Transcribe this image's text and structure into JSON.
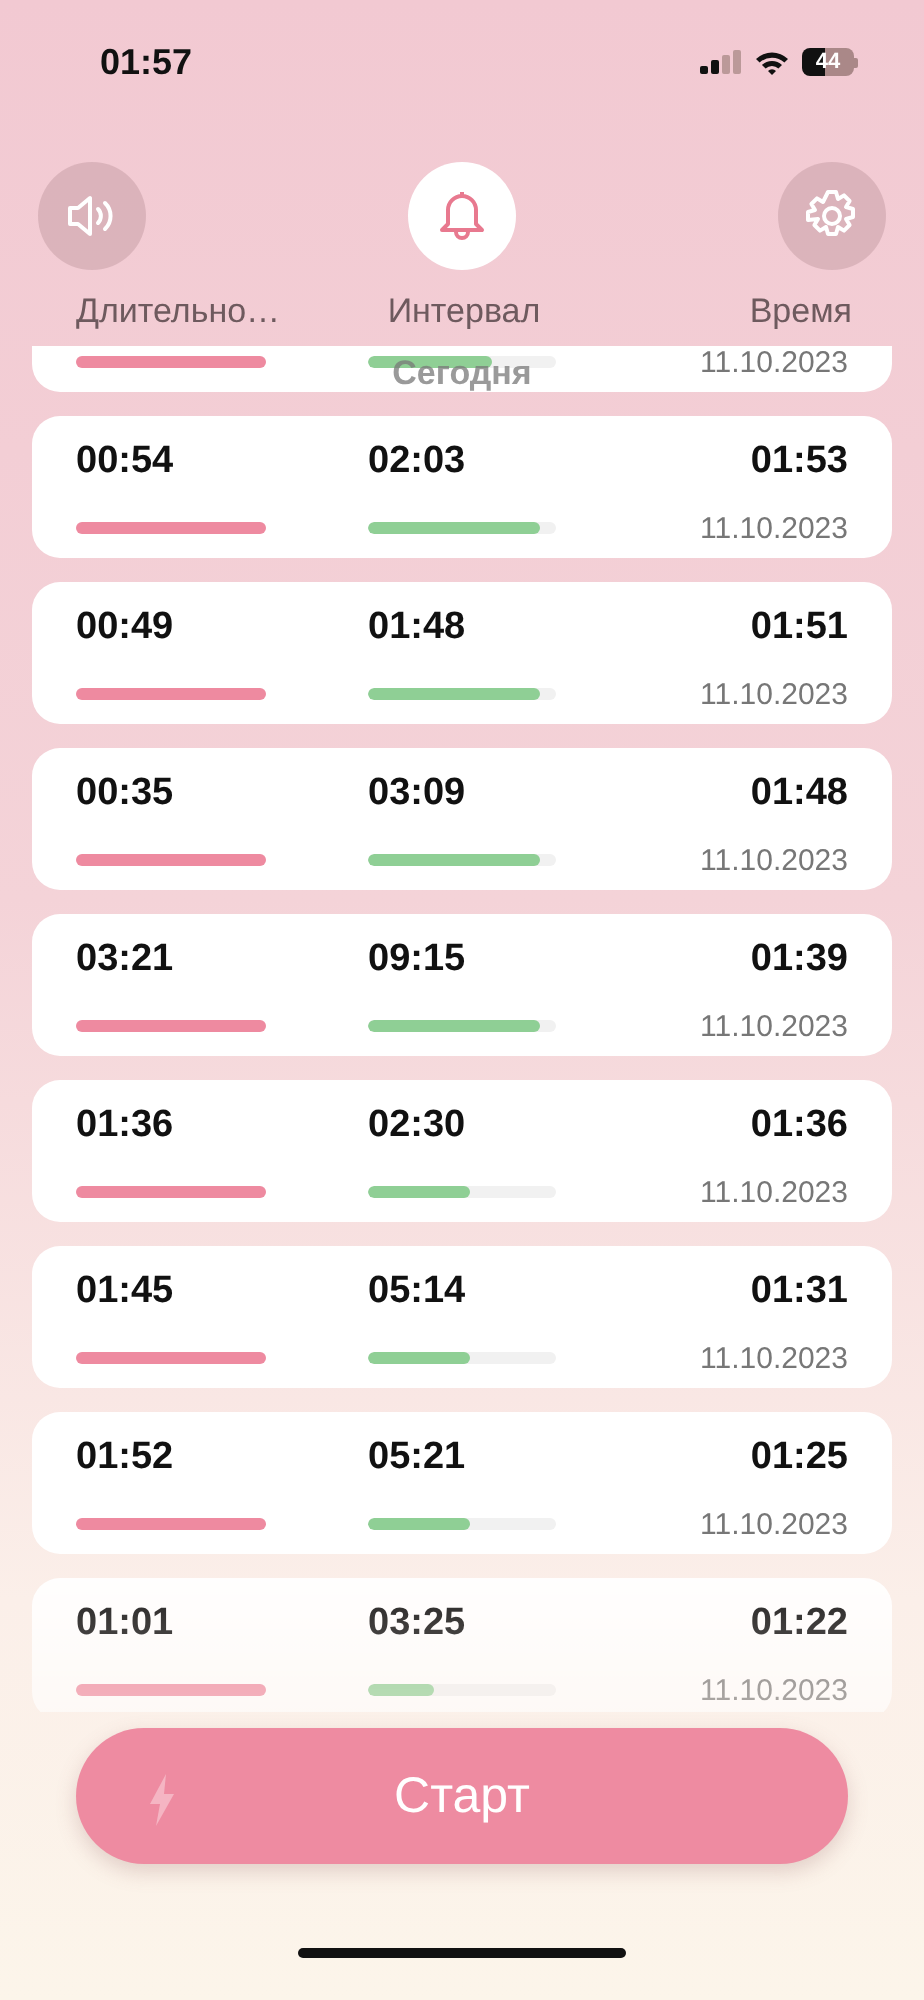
{
  "status_bar": {
    "time": "01:57",
    "battery": "44"
  },
  "tabs": [
    {
      "label": "Длительно…",
      "selected": false
    },
    {
      "label": "Интервал",
      "selected": true
    },
    {
      "label": "Время",
      "selected": false
    }
  ],
  "section_header": "Сегодня",
  "records": [
    {
      "interval_bar": {
        "level": 0.66
      },
      "date": "11.10.2023"
    },
    {
      "duration": "00:54",
      "interval": "02:03",
      "time": "01:53",
      "interval_bar": {
        "level": 0.92
      },
      "date": "11.10.2023"
    },
    {
      "duration": "00:49",
      "interval": "01:48",
      "time": "01:51",
      "interval_bar": {
        "level": 0.92
      },
      "date": "11.10.2023"
    },
    {
      "duration": "00:35",
      "interval": "03:09",
      "time": "01:48",
      "interval_bar": {
        "level": 0.92
      },
      "date": "11.10.2023"
    },
    {
      "duration": "03:21",
      "interval": "09:15",
      "time": "01:39",
      "interval_bar": {
        "level": 0.92
      },
      "date": "11.10.2023"
    },
    {
      "duration": "01:36",
      "interval": "02:30",
      "time": "01:36",
      "interval_bar": {
        "level": 0.54
      },
      "date": "11.10.2023"
    },
    {
      "duration": "01:45",
      "interval": "05:14",
      "time": "01:31",
      "interval_bar": {
        "level": 0.54
      },
      "date": "11.10.2023"
    },
    {
      "duration": "01:52",
      "interval": "05:21",
      "time": "01:25",
      "interval_bar": {
        "level": 0.54
      },
      "date": "11.10.2023"
    },
    {
      "duration": "01:01",
      "interval": "03:25",
      "time": "01:22",
      "interval_bar": {
        "level": 0.35
      },
      "date": "11.10.2023"
    }
  ],
  "start_button": {
    "label": "Старт"
  }
}
